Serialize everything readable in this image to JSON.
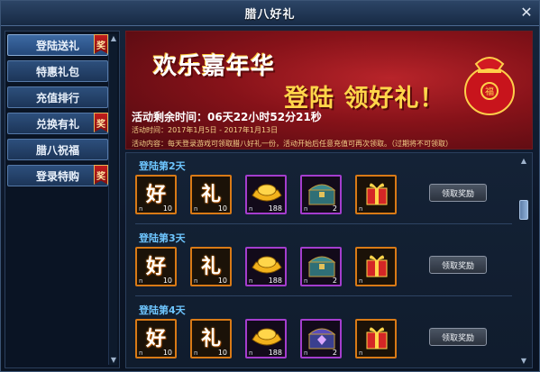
{
  "window": {
    "title": "腊八好礼"
  },
  "icons": {
    "close": "close-icon",
    "badge": "jiang-badge"
  },
  "sidebar": {
    "items": [
      {
        "label": "登陆送礼",
        "badge": "奖",
        "active": true
      },
      {
        "label": "特惠礼包",
        "badge": ""
      },
      {
        "label": "充值排行",
        "badge": ""
      },
      {
        "label": "兑换有礼",
        "badge": "奖"
      },
      {
        "label": "腊八祝福",
        "badge": ""
      },
      {
        "label": "登录特购",
        "badge": "奖"
      }
    ]
  },
  "banner": {
    "headline1": "欢乐嘉年华",
    "headline2": "登陆 领好礼！",
    "time_remaining": "活动剩余时间：06天22小时52分21秒",
    "date_range": "活动时间：2017年1月5日 - 2017年1月13日",
    "content": "活动内容：每天登录游戏可领取腊八好礼一份，活动开始后任意充值可再次领取。（过期将不可领取）"
  },
  "rewards": {
    "rows": [
      {
        "day": "登陆第2天",
        "claim_label": "领取奖励",
        "items": [
          {
            "icon": "hao-char",
            "char": "好",
            "count": "10",
            "n": "n"
          },
          {
            "icon": "li-char",
            "char": "礼",
            "count": "10",
            "n": "n"
          },
          {
            "icon": "gold-ingot-icon",
            "count": "188",
            "n": "n"
          },
          {
            "icon": "treasure-chest-icon",
            "count": "2",
            "n": "n"
          },
          {
            "icon": "gift-box-icon",
            "count": "",
            "n": "n"
          }
        ]
      },
      {
        "day": "登陆第3天",
        "claim_label": "领取奖励",
        "items": [
          {
            "icon": "hao-char",
            "char": "好",
            "count": "10",
            "n": "n"
          },
          {
            "icon": "li-char",
            "char": "礼",
            "count": "10",
            "n": "n"
          },
          {
            "icon": "gold-ingot-icon",
            "count": "188",
            "n": "n"
          },
          {
            "icon": "treasure-chest-icon",
            "count": "2",
            "n": "n"
          },
          {
            "icon": "gift-box-icon",
            "count": "",
            "n": "n"
          }
        ]
      },
      {
        "day": "登陆第4天",
        "claim_label": "领取奖励",
        "items": [
          {
            "icon": "hao-char",
            "char": "好",
            "count": "10",
            "n": "n"
          },
          {
            "icon": "li-char",
            "char": "礼",
            "count": "10",
            "n": "n"
          },
          {
            "icon": "gold-ingot-icon",
            "count": "188",
            "n": "n"
          },
          {
            "icon": "amethyst-chest-icon",
            "count": "2",
            "n": "n"
          },
          {
            "icon": "gift-box-icon",
            "count": "",
            "n": "n"
          }
        ]
      }
    ]
  },
  "colors": {
    "accent_blue": "#6ec6ff",
    "banner_red": "#861219",
    "gold": "#ffd54a",
    "slot_orange": "#d97a16",
    "slot_purple": "#a43dce"
  }
}
